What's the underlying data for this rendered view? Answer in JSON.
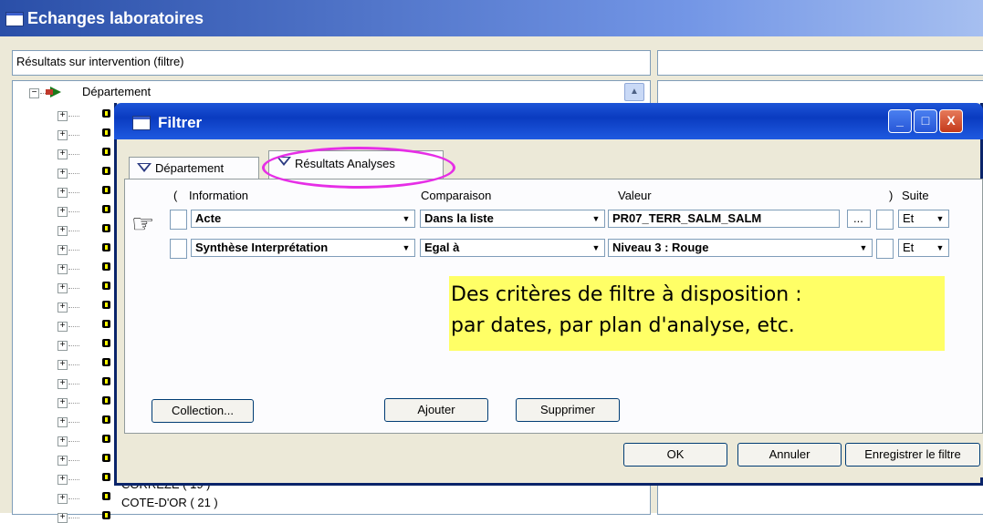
{
  "main_window": {
    "title": "Echanges laboratoires",
    "panel_header": "Résultats sur intervention (filtre)",
    "tree": {
      "root_label": "Département",
      "visible_items": [
        "CORREZE ( 19 )",
        "COTE-D'OR ( 21 )"
      ]
    }
  },
  "dialog": {
    "title": "Filtrer",
    "buttons": {
      "minimize": "_",
      "maximize": "□",
      "close": "X"
    },
    "tabs": [
      {
        "label": "Département",
        "active": false
      },
      {
        "label": "Résultats Analyses",
        "active": true
      }
    ],
    "columns": {
      "open_paren": "(",
      "information": "Information",
      "comparaison": "Comparaison",
      "valeur": "Valeur",
      "close_paren": ")",
      "suite": "Suite"
    },
    "rows": [
      {
        "information": "Acte",
        "comparaison": "Dans la liste",
        "valeur": "PR07_TERR_SALM_SALM",
        "suite": "Et",
        "browse": "..."
      },
      {
        "information": "Synthèse Interprétation",
        "comparaison": "Egal à",
        "valeur": "Niveau 3 : Rouge",
        "suite": "Et"
      }
    ],
    "buttons_panel": {
      "collection": "Collection...",
      "ajouter": "Ajouter",
      "supprimer": "Supprimer"
    },
    "footer": {
      "ok": "OK",
      "annuler": "Annuler",
      "enregistrer": "Enregistrer le filtre"
    }
  },
  "annotation": {
    "line1": "Des critères de filtre à disposition :",
    "line2": "par dates, par plan d'analyse, etc."
  },
  "colors": {
    "annotation_bg": "#ffff66",
    "highlight": "#e62ee6",
    "dialog_title": "#0a3bc0"
  }
}
